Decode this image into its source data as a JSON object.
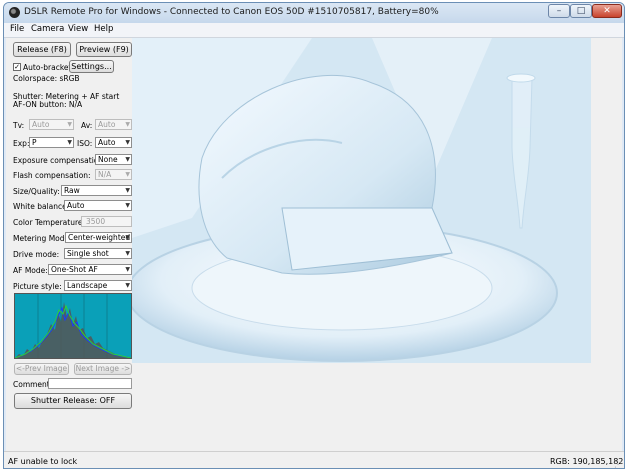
{
  "window": {
    "title": "DSLR Remote Pro for Windows - Connected to Canon EOS 50D #1510705817, Battery=80%",
    "controls": {
      "minimize": "–",
      "maximize": "□",
      "close": "✕"
    }
  },
  "menu": {
    "items": [
      "File",
      "Camera",
      "View",
      "Help"
    ]
  },
  "panel": {
    "release_label": "Release (F8)",
    "preview_label": "Preview (F9)",
    "auto_bracket_label": "Auto-bracket",
    "auto_bracket_checked": "✓",
    "settings_label": "Settings...",
    "colorspace": "Colorspace: sRGB",
    "shutter_info": "Shutter: Metering + AF start",
    "afon_info": "AF-ON button: N/A",
    "tv_label": "Tv:",
    "tv_value": "Auto",
    "av_label": "Av:",
    "av_value": "Auto",
    "exp_label": "Exp:",
    "exp_value": "P",
    "iso_label": "ISO:",
    "iso_value": "Auto",
    "exposure_comp_label": "Exposure compensation:",
    "exposure_comp_value": "None",
    "flash_comp_label": "Flash compensation:",
    "flash_comp_value": "N/A",
    "size_quality_label": "Size/Quality:",
    "size_quality_value": "Raw",
    "white_balance_label": "White balance:",
    "white_balance_value": "Auto",
    "color_temp_label": "Color Temperature:",
    "color_temp_value": "3500",
    "metering_label": "Metering Mode:",
    "metering_value": "Center-weighted",
    "drive_label": "Drive mode:",
    "drive_value": "Single shot",
    "af_mode_label": "AF Mode:",
    "af_mode_value": "One-Shot AF",
    "picture_style_label": "Picture style:",
    "picture_style_value": "Landscape",
    "prev_image_label": "<-Prev Image",
    "next_image_label": "Next Image ->",
    "comment_label": "Comment:",
    "comment_value": "",
    "shutter_release_label": "Shutter Release: OFF"
  },
  "status": {
    "left": "AF unable to lock",
    "right": "RGB: 190,185,182"
  },
  "colors": {
    "histogram_bg": "#0aa0b8",
    "close_button": "#c8432d"
  }
}
